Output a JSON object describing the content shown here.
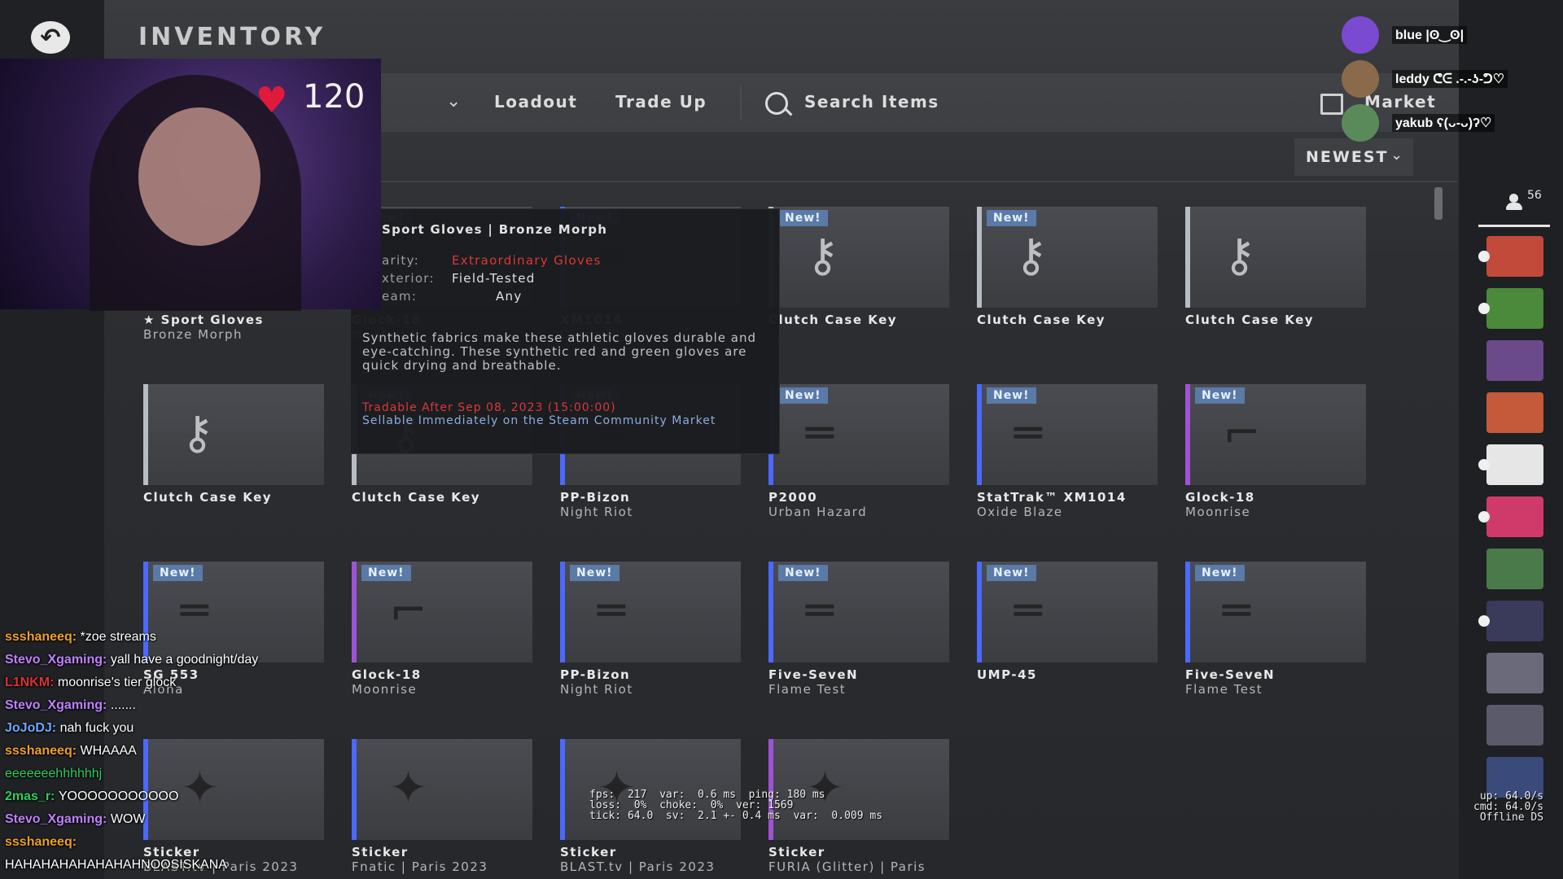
{
  "header": {
    "title": "INVENTORY"
  },
  "nav": {
    "loadout": "Loadout",
    "trade_up": "Trade Up",
    "search": "Search Items",
    "market": "Market"
  },
  "sort": {
    "label": "NEWEST"
  },
  "badge": "New!",
  "items": [
    {
      "name": "★ Sport Gloves",
      "sub": "Bronze Morph",
      "new": false,
      "rarity": "gold"
    },
    {
      "name": "Glock-18",
      "sub": "Moonrise",
      "new": true,
      "rarity": "pink"
    },
    {
      "name": "XM1014",
      "sub": "Oxide Blaze",
      "new": true,
      "rarity": "blue"
    },
    {
      "name": "Clutch Case Key",
      "sub": "",
      "new": true,
      "rarity": "gray"
    },
    {
      "name": "Clutch Case Key",
      "sub": "",
      "new": true,
      "rarity": "gray"
    },
    {
      "name": "Clutch Case Key",
      "sub": "",
      "new": false,
      "rarity": "gray"
    },
    {
      "name": "Clutch Case Key",
      "sub": "",
      "new": false,
      "rarity": "gray"
    },
    {
      "name": "Clutch Case Key",
      "sub": "",
      "new": true,
      "rarity": "gray"
    },
    {
      "name": "PP-Bizon",
      "sub": "Night Riot",
      "new": true,
      "rarity": "blue"
    },
    {
      "name": "P2000",
      "sub": "Urban Hazard",
      "new": true,
      "rarity": "blue"
    },
    {
      "name": "StatTrak™ XM1014",
      "sub": "Oxide Blaze",
      "new": true,
      "rarity": "blue"
    },
    {
      "name": "Glock-18",
      "sub": "Moonrise",
      "new": true,
      "rarity": "pink"
    },
    {
      "name": "SG 553",
      "sub": "Aloha",
      "new": true,
      "rarity": "blue"
    },
    {
      "name": "Glock-18",
      "sub": "Moonrise",
      "new": true,
      "rarity": "pink"
    },
    {
      "name": "PP-Bizon",
      "sub": "Night Riot",
      "new": true,
      "rarity": "blue"
    },
    {
      "name": "Five-SeveN",
      "sub": "Flame Test",
      "new": true,
      "rarity": "blue"
    },
    {
      "name": "UMP-45",
      "sub": "",
      "new": true,
      "rarity": "blue"
    },
    {
      "name": "Five-SeveN",
      "sub": "Flame Test",
      "new": true,
      "rarity": "blue"
    },
    {
      "name": "Sticker",
      "sub": "BLAST.tv | Paris 2023",
      "new": false,
      "rarity": "blue"
    },
    {
      "name": "Sticker",
      "sub": "Fnatic | Paris 2023",
      "new": false,
      "rarity": "blue"
    },
    {
      "name": "Sticker",
      "sub": "BLAST.tv | Paris 2023",
      "new": false,
      "rarity": "blue"
    },
    {
      "name": "Sticker",
      "sub": "FURIA (Glitter) | Paris",
      "new": false,
      "rarity": "pink"
    }
  ],
  "tooltip": {
    "title": "Sport Gloves | Bronze Morph",
    "rarity_label": "arity:",
    "rarity_value": "Extraordinary Gloves",
    "exterior_label": "xterior:",
    "exterior_value": "Field-Tested",
    "team_label": "eam:",
    "team_value": "Any",
    "description": "Synthetic fabrics make these athletic gloves durable and eye-catching. These synthetic red and green gloves are quick drying and breathable.",
    "tradable": "Tradable After Sep 08, 2023 (15:00:00)",
    "sellable": "Sellable Immediately on the Steam Community Market"
  },
  "overlay": {
    "hp": "120",
    "viewers": "56",
    "stream_names": [
      "blue |ʘ‿ʘ|",
      "leddy ᕦᕮ .-.-ʖ-ᕤ♡",
      "yakub ʕ(ᴗ-ᴗ)ʔ♡"
    ],
    "fps_text": "fps:  217  var:  0.6 ms  ping: 180 ms\nloss:  0%  choke:  0%  ver: 1569\ntick: 64.0  sv:  2.1 +- 0.4 ms  var:  0.009 ms",
    "net_text": "up: 64.0/s\ncmd: 64.0/s\nOffline DS"
  },
  "chat": [
    {
      "user": "ssshaneeq",
      "msg": "*zoe streams",
      "color": "#f0a020"
    },
    {
      "user": "Stevo_Xgaming",
      "msg": "yall have a goodnight/day",
      "color": "#c080ff"
    },
    {
      "user": "L1NKM",
      "msg": "moonrise's tier glock",
      "color": "#e03030"
    },
    {
      "user": "Stevo_Xgaming",
      "msg": ".......",
      "color": "#c080ff"
    },
    {
      "user": "JoJoDJ",
      "msg": "nah fuck you",
      "color": "#6fa8ff"
    },
    {
      "user": "ssshaneeq",
      "msg": "WHAAAA",
      "color": "#f0a020"
    },
    {
      "user": "",
      "msg": "eeeeeeehhhhhhj",
      "color": "#2ad060"
    },
    {
      "user": "2mas_r",
      "msg": "YOOOOOOOOOOO",
      "color": "#2ad060"
    },
    {
      "user": "Stevo_Xgaming",
      "msg": "WOW",
      "color": "#c080ff"
    },
    {
      "user": "ssshaneeq",
      "msg": "",
      "color": "#f0a020"
    },
    {
      "user": "",
      "msg": "HAHAHAHAHAHAHAHNOOSISKANA",
      "color": "#ffffff"
    }
  ],
  "colors": {
    "gold": "#c6b27a",
    "blue": "#4b69ff",
    "pink": "#a052d6",
    "gray": "#b8bcc4",
    "badge": "#5a7aa8",
    "heart": "#e01a3c"
  }
}
